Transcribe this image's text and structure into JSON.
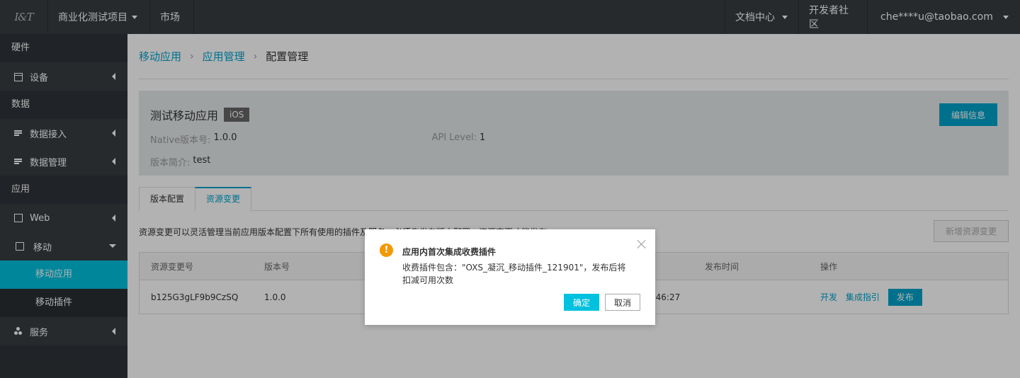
{
  "topbar": {
    "logo_text": "I&T",
    "project": "商业化测试项目",
    "market": "市场",
    "docs": "文档中心",
    "community": "开发者社区",
    "user": "che****u@taobao.com"
  },
  "sidebar": {
    "groups": [
      "硬件",
      "数据",
      "应用"
    ],
    "items": {
      "device": "设备",
      "data_access": "数据接入",
      "data_manage": "数据管理",
      "web": "Web",
      "mobile": "移动",
      "mobile_app": "移动应用",
      "mobile_plugin": "移动插件",
      "service": "服务"
    }
  },
  "breadcrumb": [
    "移动应用",
    "应用管理",
    "配置管理"
  ],
  "app_info": {
    "name": "测试移动应用",
    "platform": "iOS",
    "native_version_label": "Native版本号:",
    "native_version": "1.0.0",
    "api_level_label": "API Level:",
    "api_level": "1",
    "intro_label": "版本简介:",
    "intro": "test",
    "edit_button": "编辑信息"
  },
  "tabs": [
    "版本配置",
    "资源变更"
  ],
  "description": "资源变更可以灵活管理当前应用版本配置下所有使用的插件及服务，必须先发布版本配置，资源变更才能发布。",
  "new_change_button": "新增资源变更",
  "table": {
    "headers": [
      "资源变更号",
      "版本号",
      "发布时间",
      "操作"
    ],
    "row": {
      "id": "b125G3gLF9b9CzSQ",
      "version": "1.0.0",
      "time_fragment": "c:46:27",
      "actions": [
        "开发",
        "集成指引",
        "发布"
      ]
    }
  },
  "dialog": {
    "icon": "warning-icon",
    "title": "应用内首次集成收费插件",
    "body": "收费插件包含：\"OXS_凝沉_移动插件_121901\"，发布后将扣减可用次数",
    "ok": "确定",
    "cancel": "取消"
  }
}
